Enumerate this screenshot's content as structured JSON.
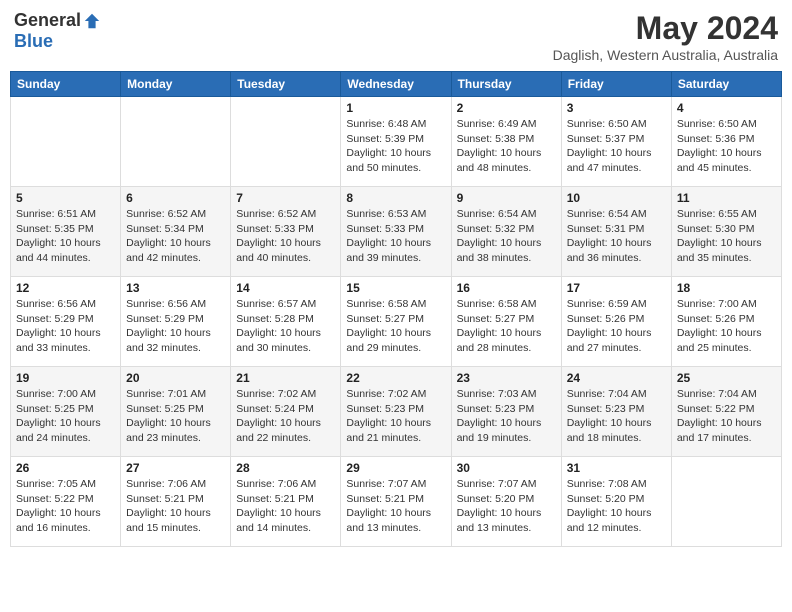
{
  "header": {
    "logo_general": "General",
    "logo_blue": "Blue",
    "month_title": "May 2024",
    "location": "Daglish, Western Australia, Australia"
  },
  "weekdays": [
    "Sunday",
    "Monday",
    "Tuesday",
    "Wednesday",
    "Thursday",
    "Friday",
    "Saturday"
  ],
  "weeks": [
    [
      {
        "day": "",
        "info": ""
      },
      {
        "day": "",
        "info": ""
      },
      {
        "day": "",
        "info": ""
      },
      {
        "day": "1",
        "info": "Sunrise: 6:48 AM\nSunset: 5:39 PM\nDaylight: 10 hours\nand 50 minutes."
      },
      {
        "day": "2",
        "info": "Sunrise: 6:49 AM\nSunset: 5:38 PM\nDaylight: 10 hours\nand 48 minutes."
      },
      {
        "day": "3",
        "info": "Sunrise: 6:50 AM\nSunset: 5:37 PM\nDaylight: 10 hours\nand 47 minutes."
      },
      {
        "day": "4",
        "info": "Sunrise: 6:50 AM\nSunset: 5:36 PM\nDaylight: 10 hours\nand 45 minutes."
      }
    ],
    [
      {
        "day": "5",
        "info": "Sunrise: 6:51 AM\nSunset: 5:35 PM\nDaylight: 10 hours\nand 44 minutes."
      },
      {
        "day": "6",
        "info": "Sunrise: 6:52 AM\nSunset: 5:34 PM\nDaylight: 10 hours\nand 42 minutes."
      },
      {
        "day": "7",
        "info": "Sunrise: 6:52 AM\nSunset: 5:33 PM\nDaylight: 10 hours\nand 40 minutes."
      },
      {
        "day": "8",
        "info": "Sunrise: 6:53 AM\nSunset: 5:33 PM\nDaylight: 10 hours\nand 39 minutes."
      },
      {
        "day": "9",
        "info": "Sunrise: 6:54 AM\nSunset: 5:32 PM\nDaylight: 10 hours\nand 38 minutes."
      },
      {
        "day": "10",
        "info": "Sunrise: 6:54 AM\nSunset: 5:31 PM\nDaylight: 10 hours\nand 36 minutes."
      },
      {
        "day": "11",
        "info": "Sunrise: 6:55 AM\nSunset: 5:30 PM\nDaylight: 10 hours\nand 35 minutes."
      }
    ],
    [
      {
        "day": "12",
        "info": "Sunrise: 6:56 AM\nSunset: 5:29 PM\nDaylight: 10 hours\nand 33 minutes."
      },
      {
        "day": "13",
        "info": "Sunrise: 6:56 AM\nSunset: 5:29 PM\nDaylight: 10 hours\nand 32 minutes."
      },
      {
        "day": "14",
        "info": "Sunrise: 6:57 AM\nSunset: 5:28 PM\nDaylight: 10 hours\nand 30 minutes."
      },
      {
        "day": "15",
        "info": "Sunrise: 6:58 AM\nSunset: 5:27 PM\nDaylight: 10 hours\nand 29 minutes."
      },
      {
        "day": "16",
        "info": "Sunrise: 6:58 AM\nSunset: 5:27 PM\nDaylight: 10 hours\nand 28 minutes."
      },
      {
        "day": "17",
        "info": "Sunrise: 6:59 AM\nSunset: 5:26 PM\nDaylight: 10 hours\nand 27 minutes."
      },
      {
        "day": "18",
        "info": "Sunrise: 7:00 AM\nSunset: 5:26 PM\nDaylight: 10 hours\nand 25 minutes."
      }
    ],
    [
      {
        "day": "19",
        "info": "Sunrise: 7:00 AM\nSunset: 5:25 PM\nDaylight: 10 hours\nand 24 minutes."
      },
      {
        "day": "20",
        "info": "Sunrise: 7:01 AM\nSunset: 5:25 PM\nDaylight: 10 hours\nand 23 minutes."
      },
      {
        "day": "21",
        "info": "Sunrise: 7:02 AM\nSunset: 5:24 PM\nDaylight: 10 hours\nand 22 minutes."
      },
      {
        "day": "22",
        "info": "Sunrise: 7:02 AM\nSunset: 5:23 PM\nDaylight: 10 hours\nand 21 minutes."
      },
      {
        "day": "23",
        "info": "Sunrise: 7:03 AM\nSunset: 5:23 PM\nDaylight: 10 hours\nand 19 minutes."
      },
      {
        "day": "24",
        "info": "Sunrise: 7:04 AM\nSunset: 5:23 PM\nDaylight: 10 hours\nand 18 minutes."
      },
      {
        "day": "25",
        "info": "Sunrise: 7:04 AM\nSunset: 5:22 PM\nDaylight: 10 hours\nand 17 minutes."
      }
    ],
    [
      {
        "day": "26",
        "info": "Sunrise: 7:05 AM\nSunset: 5:22 PM\nDaylight: 10 hours\nand 16 minutes."
      },
      {
        "day": "27",
        "info": "Sunrise: 7:06 AM\nSunset: 5:21 PM\nDaylight: 10 hours\nand 15 minutes."
      },
      {
        "day": "28",
        "info": "Sunrise: 7:06 AM\nSunset: 5:21 PM\nDaylight: 10 hours\nand 14 minutes."
      },
      {
        "day": "29",
        "info": "Sunrise: 7:07 AM\nSunset: 5:21 PM\nDaylight: 10 hours\nand 13 minutes."
      },
      {
        "day": "30",
        "info": "Sunrise: 7:07 AM\nSunset: 5:20 PM\nDaylight: 10 hours\nand 13 minutes."
      },
      {
        "day": "31",
        "info": "Sunrise: 7:08 AM\nSunset: 5:20 PM\nDaylight: 10 hours\nand 12 minutes."
      },
      {
        "day": "",
        "info": ""
      }
    ]
  ]
}
